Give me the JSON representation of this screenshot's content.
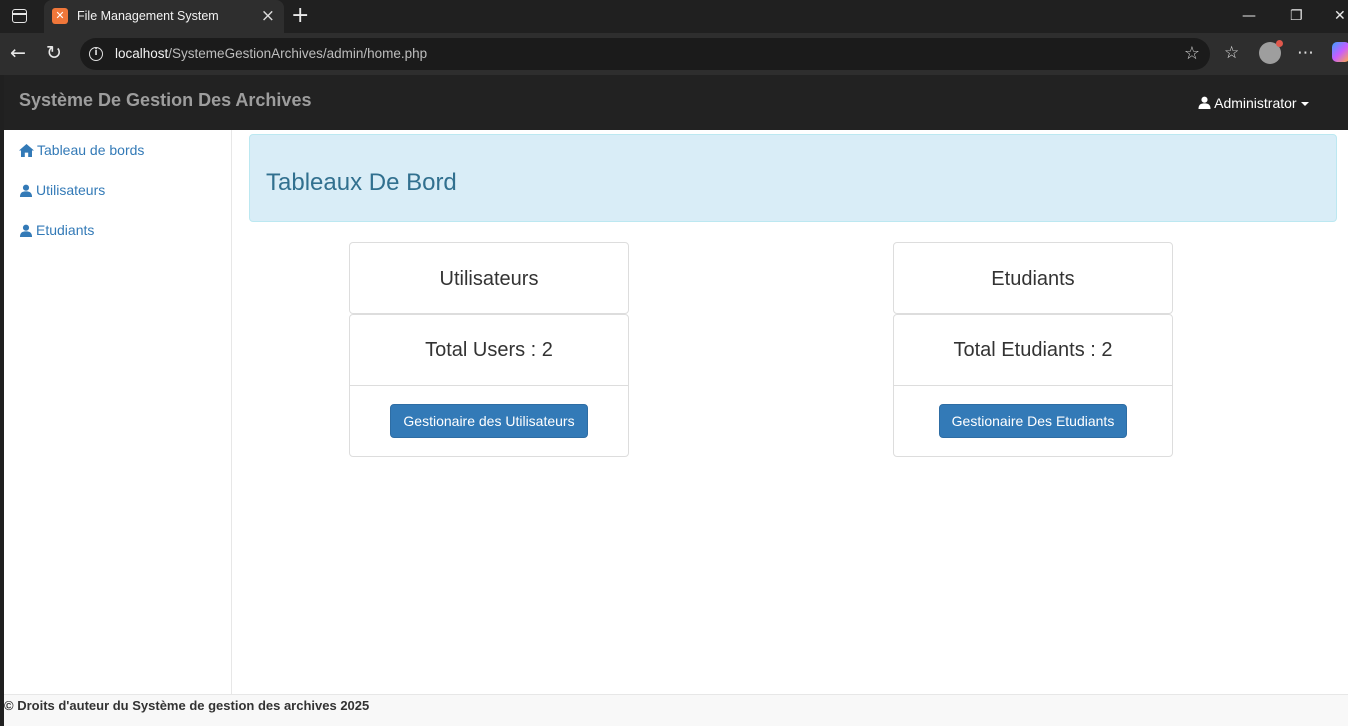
{
  "browser": {
    "tab_title": "File Management System",
    "url_host": "localhost",
    "url_path": "/SystemeGestionArchives/admin/home.php"
  },
  "navbar": {
    "brand": "Système De Gestion Des Archives",
    "user": "Administrator"
  },
  "sidebar": {
    "items": [
      {
        "label": "Tableau de bords",
        "icon": "home-icon"
      },
      {
        "label": "Utilisateurs",
        "icon": "user-icon"
      },
      {
        "label": "Etudiants",
        "icon": "user-icon"
      }
    ]
  },
  "main": {
    "title": "Tableaux De Bord",
    "cards": [
      {
        "title": "Utilisateurs",
        "total": "Total Users : 2",
        "button": "Gestionaire des Utilisateurs"
      },
      {
        "title": "Etudiants",
        "total": "Total Etudiants : 2",
        "button": "Gestionaire Des Etudiants"
      }
    ]
  },
  "footer": {
    "text": "© Droits d'auteur du Système de gestion des archives 2025"
  },
  "colors": {
    "navbar": "#222222",
    "link": "#337ab7",
    "info_bg": "#d9edf7",
    "info_text": "#31708f",
    "primary_button": "#337ab7"
  }
}
